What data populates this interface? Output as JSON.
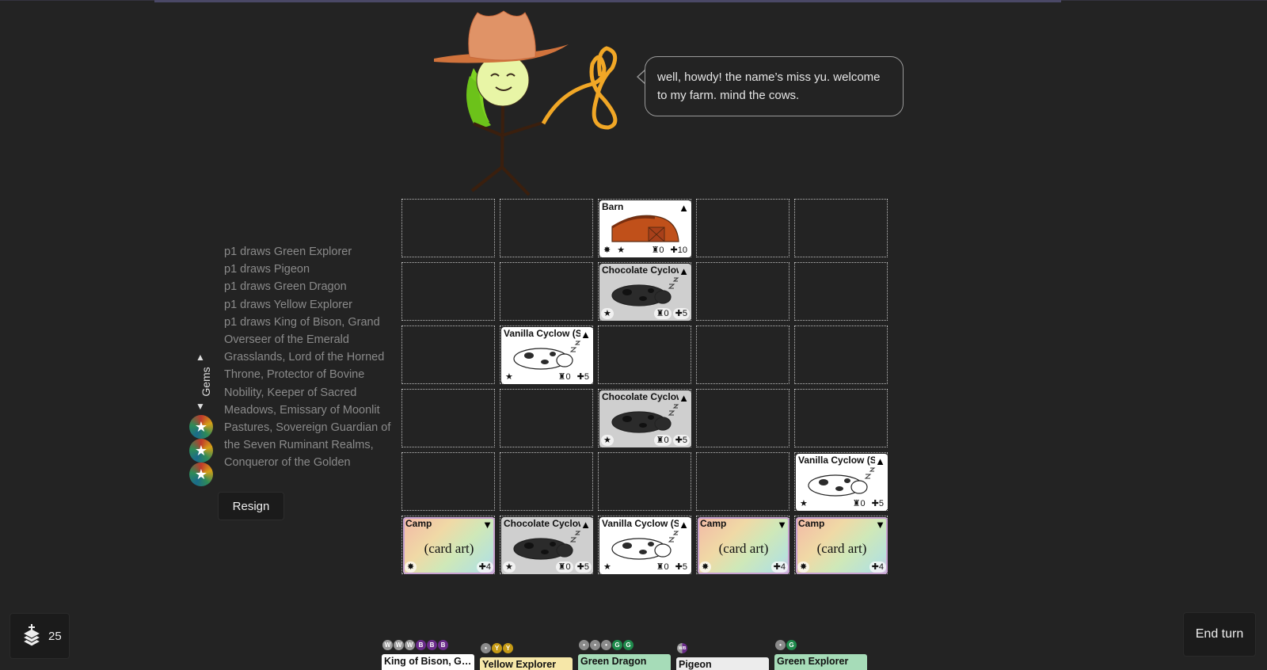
{
  "character": {
    "dialogue": "well, howdy! the name’s miss yu. welcome to my farm. mind the cows."
  },
  "log": {
    "lines": [
      "p1 draws Green Explorer",
      "p1 draws Pigeon",
      "p1 draws Green Dragon",
      "p1 draws Yellow Explorer",
      "p1 draws King of Bison, Grand Overseer of the Emerald Grasslands, Lord of the Horned Throne, Protector of Bovine Nobility, Keeper of Sacred Meadows, Emissary of Moonlit Pastures, Sovereign Guardian of the Seven Ruminant Realms, Conqueror of the Golden"
    ]
  },
  "gems": {
    "label": "Gems",
    "up": "▲",
    "down": "▼",
    "count": 3
  },
  "buttons": {
    "resign": "Resign",
    "end_turn": "End turn"
  },
  "deck": {
    "count": "25"
  },
  "board": {
    "cards": [
      {
        "row": 0,
        "col": 2,
        "name": "Barn",
        "style": "white",
        "arrow": "▲",
        "art": "barn",
        "left": [
          "✸",
          "★"
        ],
        "right": [
          {
            "icon": "♜",
            "val": "0"
          },
          {
            "icon": "✚",
            "val": "10"
          }
        ]
      },
      {
        "row": 1,
        "col": 2,
        "name": "Chocolate Cyclow",
        "style": "grey",
        "arrow": "▲",
        "art": "cow-dark",
        "left": [
          "★"
        ],
        "right": [
          {
            "icon": "♜",
            "val": "0"
          },
          {
            "icon": "✚",
            "val": "5"
          }
        ]
      },
      {
        "row": 2,
        "col": 1,
        "name": "Vanilla Cyclow (Sl",
        "style": "white",
        "arrow": "▲",
        "art": "cow-light",
        "left": [
          "★"
        ],
        "right": [
          {
            "icon": "♜",
            "val": "0"
          },
          {
            "icon": "✚",
            "val": "5"
          }
        ]
      },
      {
        "row": 3,
        "col": 2,
        "name": "Chocolate Cyclow",
        "style": "grey",
        "arrow": "▲",
        "art": "cow-dark",
        "left": [
          "★"
        ],
        "right": [
          {
            "icon": "♜",
            "val": "0"
          },
          {
            "icon": "✚",
            "val": "5"
          }
        ]
      },
      {
        "row": 4,
        "col": 4,
        "name": "Vanilla Cyclow (Sl",
        "style": "white",
        "arrow": "▲",
        "art": "cow-light",
        "left": [
          "★"
        ],
        "right": [
          {
            "icon": "♜",
            "val": "0"
          },
          {
            "icon": "✚",
            "val": "5"
          }
        ]
      },
      {
        "row": 5,
        "col": 0,
        "name": "Camp",
        "style": "camp",
        "arrow": "▼",
        "art": "text",
        "art_text": "(card art)",
        "left": [
          "✸"
        ],
        "right": [
          {
            "icon": "✚",
            "val": "4"
          }
        ]
      },
      {
        "row": 5,
        "col": 1,
        "name": "Chocolate Cyclow",
        "style": "grey",
        "arrow": "▲",
        "art": "cow-dark",
        "left": [
          "★"
        ],
        "right": [
          {
            "icon": "♜",
            "val": "0"
          },
          {
            "icon": "✚",
            "val": "5"
          }
        ]
      },
      {
        "row": 5,
        "col": 2,
        "name": "Vanilla Cyclow (Sl",
        "style": "white",
        "arrow": "▲",
        "art": "cow-light",
        "left": [
          "★"
        ],
        "right": [
          {
            "icon": "♜",
            "val": "0"
          },
          {
            "icon": "✚",
            "val": "5"
          }
        ]
      },
      {
        "row": 5,
        "col": 3,
        "name": "Camp",
        "style": "camp",
        "arrow": "▼",
        "art": "text",
        "art_text": "(card art)",
        "left": [
          "✸"
        ],
        "right": [
          {
            "icon": "✚",
            "val": "4"
          }
        ]
      },
      {
        "row": 5,
        "col": 4,
        "name": "Camp",
        "style": "camp",
        "arrow": "▼",
        "art": "text",
        "art_text": "(card art)",
        "left": [
          "✸"
        ],
        "right": [
          {
            "icon": "✚",
            "val": "4"
          }
        ]
      }
    ]
  },
  "hand": [
    {
      "name": "King of Bison, Gra...",
      "color": "#ffffff",
      "cost": [
        "W",
        "W",
        "W",
        "B",
        "B",
        "B"
      ]
    },
    {
      "name": "Yellow Explorer",
      "color": "#f6e7a8",
      "cost": [
        "•",
        "Y",
        "Y"
      ]
    },
    {
      "name": "Green Dragon",
      "color": "#a6dcb8",
      "cost": [
        "•",
        "•",
        "•",
        "G",
        "G"
      ]
    },
    {
      "name": "Pigeon",
      "color": "#ececec",
      "cost": [
        "W/B"
      ]
    },
    {
      "name": "Green Explorer",
      "color": "#a6dcb8",
      "cost": [
        "•",
        "G"
      ]
    }
  ]
}
